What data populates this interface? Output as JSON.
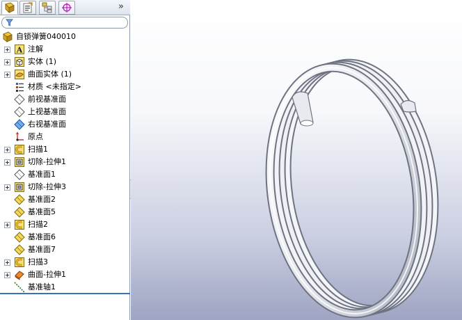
{
  "tabs": [
    {
      "name": "FeatureManager",
      "icon": "feature-manager-icon",
      "active": true
    },
    {
      "name": "PropertyManager",
      "icon": "property-manager-icon",
      "active": false
    },
    {
      "name": "ConfigurationManager",
      "icon": "configuration-manager-icon",
      "active": false
    },
    {
      "name": "DimXpertManager",
      "icon": "dimxpert-icon",
      "active": false
    }
  ],
  "overflow_symbol": "»",
  "tree": {
    "root": {
      "label": "自锁弹簧040010",
      "icon": "part-icon"
    },
    "items": [
      {
        "label": "注解",
        "icon": "annotations-icon",
        "expandable": true
      },
      {
        "label": "实体 (1)",
        "icon": "solid-bodies-icon",
        "expandable": true
      },
      {
        "label": "曲面实体 (1)",
        "icon": "surface-bodies-icon",
        "expandable": true
      },
      {
        "label": "材质 <未指定>",
        "icon": "material-icon",
        "expandable": false
      },
      {
        "label": "前视基准面",
        "icon": "plane-icon",
        "expandable": false
      },
      {
        "label": "上视基准面",
        "icon": "plane-icon",
        "expandable": false
      },
      {
        "label": "右视基准面",
        "icon": "plane-selected-icon",
        "expandable": false
      },
      {
        "label": "原点",
        "icon": "origin-icon",
        "expandable": false
      },
      {
        "label": "扫描1",
        "icon": "sweep-icon",
        "expandable": true
      },
      {
        "label": "切除-拉伸1",
        "icon": "cut-extrude-icon",
        "expandable": true
      },
      {
        "label": "基准面1",
        "icon": "plane-icon",
        "expandable": false
      },
      {
        "label": "切除-拉伸3",
        "icon": "cut-extrude-icon",
        "expandable": true
      },
      {
        "label": "基准面2",
        "icon": "ref-plane-icon",
        "expandable": false
      },
      {
        "label": "基准面5",
        "icon": "ref-plane-icon",
        "expandable": false
      },
      {
        "label": "扫描2",
        "icon": "sweep-icon",
        "expandable": true
      },
      {
        "label": "基准面6",
        "icon": "ref-plane-icon",
        "expandable": false
      },
      {
        "label": "基准面7",
        "icon": "ref-plane-icon",
        "expandable": false
      },
      {
        "label": "扫描3",
        "icon": "sweep-icon",
        "expandable": true
      },
      {
        "label": "曲面-拉伸1",
        "icon": "surface-extrude-icon",
        "expandable": true
      },
      {
        "label": "基准轴1",
        "icon": "axis-icon",
        "expandable": false
      }
    ]
  },
  "colors": {
    "accent": "#3d6fb8",
    "feature_yellow": "#f5d547",
    "viewport_bottom": "#9ea4c2"
  }
}
